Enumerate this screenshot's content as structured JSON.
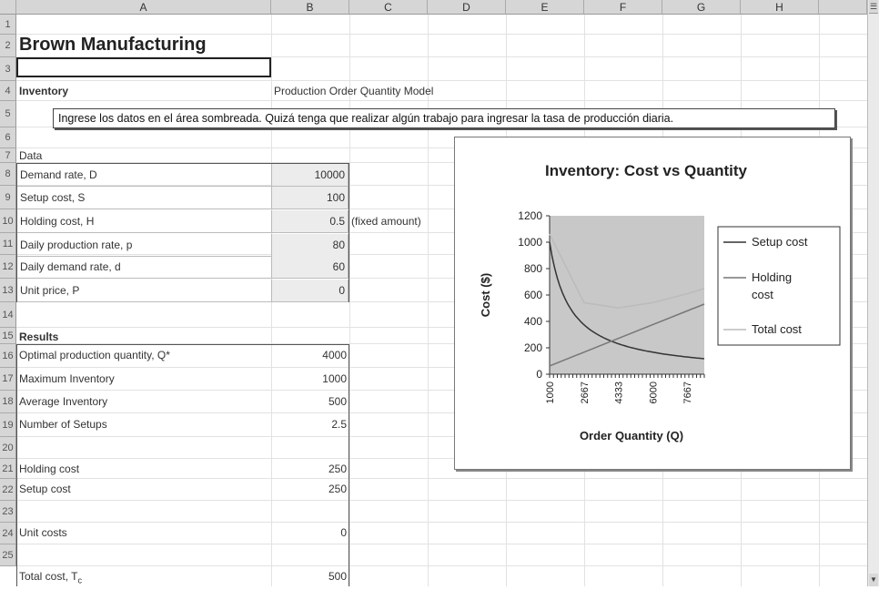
{
  "columns": [
    "A",
    "B",
    "C",
    "D",
    "E",
    "F",
    "G",
    "H"
  ],
  "rows": [
    "1",
    "2",
    "3",
    "4",
    "5",
    "6",
    "7",
    "8",
    "9",
    "10",
    "11",
    "12",
    "13",
    "14",
    "15",
    "16",
    "17",
    "18",
    "19",
    "20",
    "21",
    "22",
    "23",
    "24",
    "25"
  ],
  "sheet": {
    "title": "Brown Manufacturing",
    "inventory_label": "Inventory",
    "model_label": "Production Order Quantity Model",
    "comment": "Ingrese los datos en el área sombreada. Quizá tenga que realizar algún trabajo para ingresar la tasa de producción diaria.",
    "data_label": "Data",
    "inputs": [
      {
        "label": "Demand rate, D",
        "value": "10000"
      },
      {
        "label": "Setup cost, S",
        "value": "100"
      },
      {
        "label": "Holding cost, H",
        "value": "0.5",
        "note": "(fixed amount)"
      },
      {
        "label": "Daily production rate, p",
        "value": "80"
      },
      {
        "label": "Daily demand rate, d",
        "value": "60"
      },
      {
        "label": "Unit price, P",
        "value": "0"
      }
    ],
    "results_label": "Results",
    "results": [
      {
        "label": "Optimal production quantity, Q*",
        "value": "4000"
      },
      {
        "label": "Maximum Inventory",
        "value": "1000"
      },
      {
        "label": "Average Inventory",
        "value": "500"
      },
      {
        "label": "Number of Setups",
        "value": "2.5"
      }
    ],
    "holding_cost": {
      "label": "Holding cost",
      "value": "250"
    },
    "setup_cost": {
      "label": "Setup cost",
      "value": "250"
    },
    "unit_costs": {
      "label": "Unit costs",
      "value": "0"
    },
    "total_cost": {
      "label": "Total cost, T",
      "sub": "c",
      "value": "500"
    }
  },
  "chart_data": {
    "type": "line",
    "title": "Inventory: Cost vs Quantity",
    "xlabel": "Order Quantity (Q)",
    "ylabel": "Cost ($)",
    "ylim": [
      0,
      1200
    ],
    "yticks": [
      0,
      200,
      400,
      600,
      800,
      1000,
      1200
    ],
    "xtick_labels": [
      "1000",
      "2667",
      "4333",
      "6000",
      "7667"
    ],
    "x": [
      1000,
      2667,
      4333,
      6000,
      7667,
      8500
    ],
    "series": [
      {
        "name": "Setup cost",
        "values": [
          1000,
          375,
          231,
          167,
          130,
          118
        ],
        "color": "#333333"
      },
      {
        "name": "Holding cost",
        "values": [
          63,
          167,
          271,
          375,
          479,
          531
        ],
        "color": "#777777"
      },
      {
        "name": "Total cost",
        "values": [
          1063,
          542,
          502,
          542,
          609,
          649
        ],
        "color": "#bbbbbb"
      }
    ],
    "legend": "right",
    "plot_bg": "#c8c8c8"
  }
}
